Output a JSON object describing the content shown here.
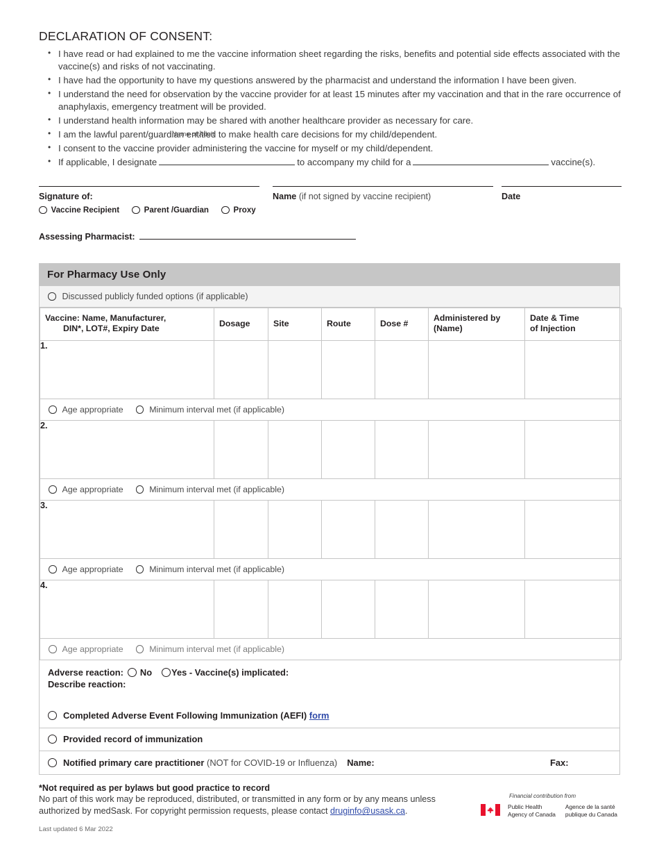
{
  "declaration": {
    "title": "DECLARATION OF CONSENT:",
    "bullets": [
      "I have read or had explained to me the vaccine information sheet regarding the risks, benefits and potential side effects associated with the vaccine(s) and risks of not vaccinating.",
      "I have had the opportunity to have my questions answered by the pharmacist and understand the information I have been given.",
      "I understand the need for observation by the vaccine provider for at least 15 minutes after my vaccination and that in the rare occurrence of anaphylaxis, emergency treatment will be provided.",
      "I understand health information may be shared with another healthcare provider as necessary for care.",
      "I am the lawful parent/guardian entitled to make health care decisions for my child/dependent.",
      "I consent to the vaccine provider administering the vaccine for myself or my child/dependent."
    ],
    "designate": {
      "prefix": "If applicable, I designate",
      "middle": "to accompany my child for a",
      "suffix": "vaccine(s).",
      "caption": "Name of Adult"
    }
  },
  "signature": {
    "signature_of_label": "Signature of:",
    "name_label": "Name",
    "name_note": "(if not signed by vaccine recipient)",
    "date_label": "Date",
    "options": [
      {
        "label": "Vaccine Recipient"
      },
      {
        "label": "Parent /Guardian"
      },
      {
        "label": "Proxy"
      }
    ],
    "assessing_pharmacist_label": "Assessing Pharmacist:"
  },
  "pharmacy": {
    "header": "For Pharmacy Use Only",
    "discussed_label": "Discussed publicly funded options (if applicable)",
    "columns": [
      {
        "line1": "Vaccine: Name, Manufacturer,",
        "line2": "DIN*, LOT#, Expiry Date"
      },
      {
        "line1": "Dosage",
        "line2": ""
      },
      {
        "line1": "Site",
        "line2": ""
      },
      {
        "line1": "Route",
        "line2": ""
      },
      {
        "line1": "Dose #",
        "line2": ""
      },
      {
        "line1": "Administered by",
        "line2": "(Name)"
      },
      {
        "line1": "Date & Time",
        "line2": "of Injection"
      }
    ],
    "rows": [
      {
        "number": "1.",
        "age_appropriate": "Age appropriate",
        "min_interval": "Minimum interval met (if applicable)"
      },
      {
        "number": "2.",
        "age_appropriate": "Age appropriate",
        "min_interval": "Minimum interval met (if applicable)"
      },
      {
        "number": "3.",
        "age_appropriate": "Age appropriate",
        "min_interval": "Minimum interval met (if applicable)"
      },
      {
        "number": "4.",
        "age_appropriate": "Age appropriate",
        "min_interval": "Minimum interval met (if applicable)"
      }
    ],
    "adverse": {
      "label": "Adverse reaction:",
      "no_label": "No",
      "yes_label": "Yes - Vaccine(s) implicated:",
      "describe_label": "Describe reaction:",
      "aefi_text": "Completed Adverse Event Following Immunization (AEFI)",
      "aefi_link": "form"
    },
    "provided_record": "Provided record of immunization",
    "notified": {
      "label": "Notified primary care practitioner",
      "note": "(NOT for COVID-19 or Influenza)",
      "name_label": "Name:",
      "fax_label": "Fax:"
    }
  },
  "footer": {
    "note_bold": "*Not required as per bylaws but good practice to record",
    "copyright_1": "No part of this work may be reproduced, distributed, or transmitted in any form or by any means unless",
    "copyright_2_pre": "authorized by medSask. For copyright permission requests, please contact ",
    "copyright_email": "druginfo@usask.ca",
    "copyright_2_post": ".",
    "last_updated": "Last updated 6 Mar 2022"
  },
  "phac": {
    "caption": "Financial contribution from",
    "english_l1": "Public Health",
    "english_l2": "Agency of Canada",
    "french_l1": "Agence de la santé",
    "french_l2": "publique du Canada"
  },
  "colors": {
    "header_gray": "#c6c6c6",
    "row_gray": "#f3f3f3",
    "link_blue": "#2f4aa8",
    "flag_red": "#e8112d",
    "text": "#231f20"
  }
}
